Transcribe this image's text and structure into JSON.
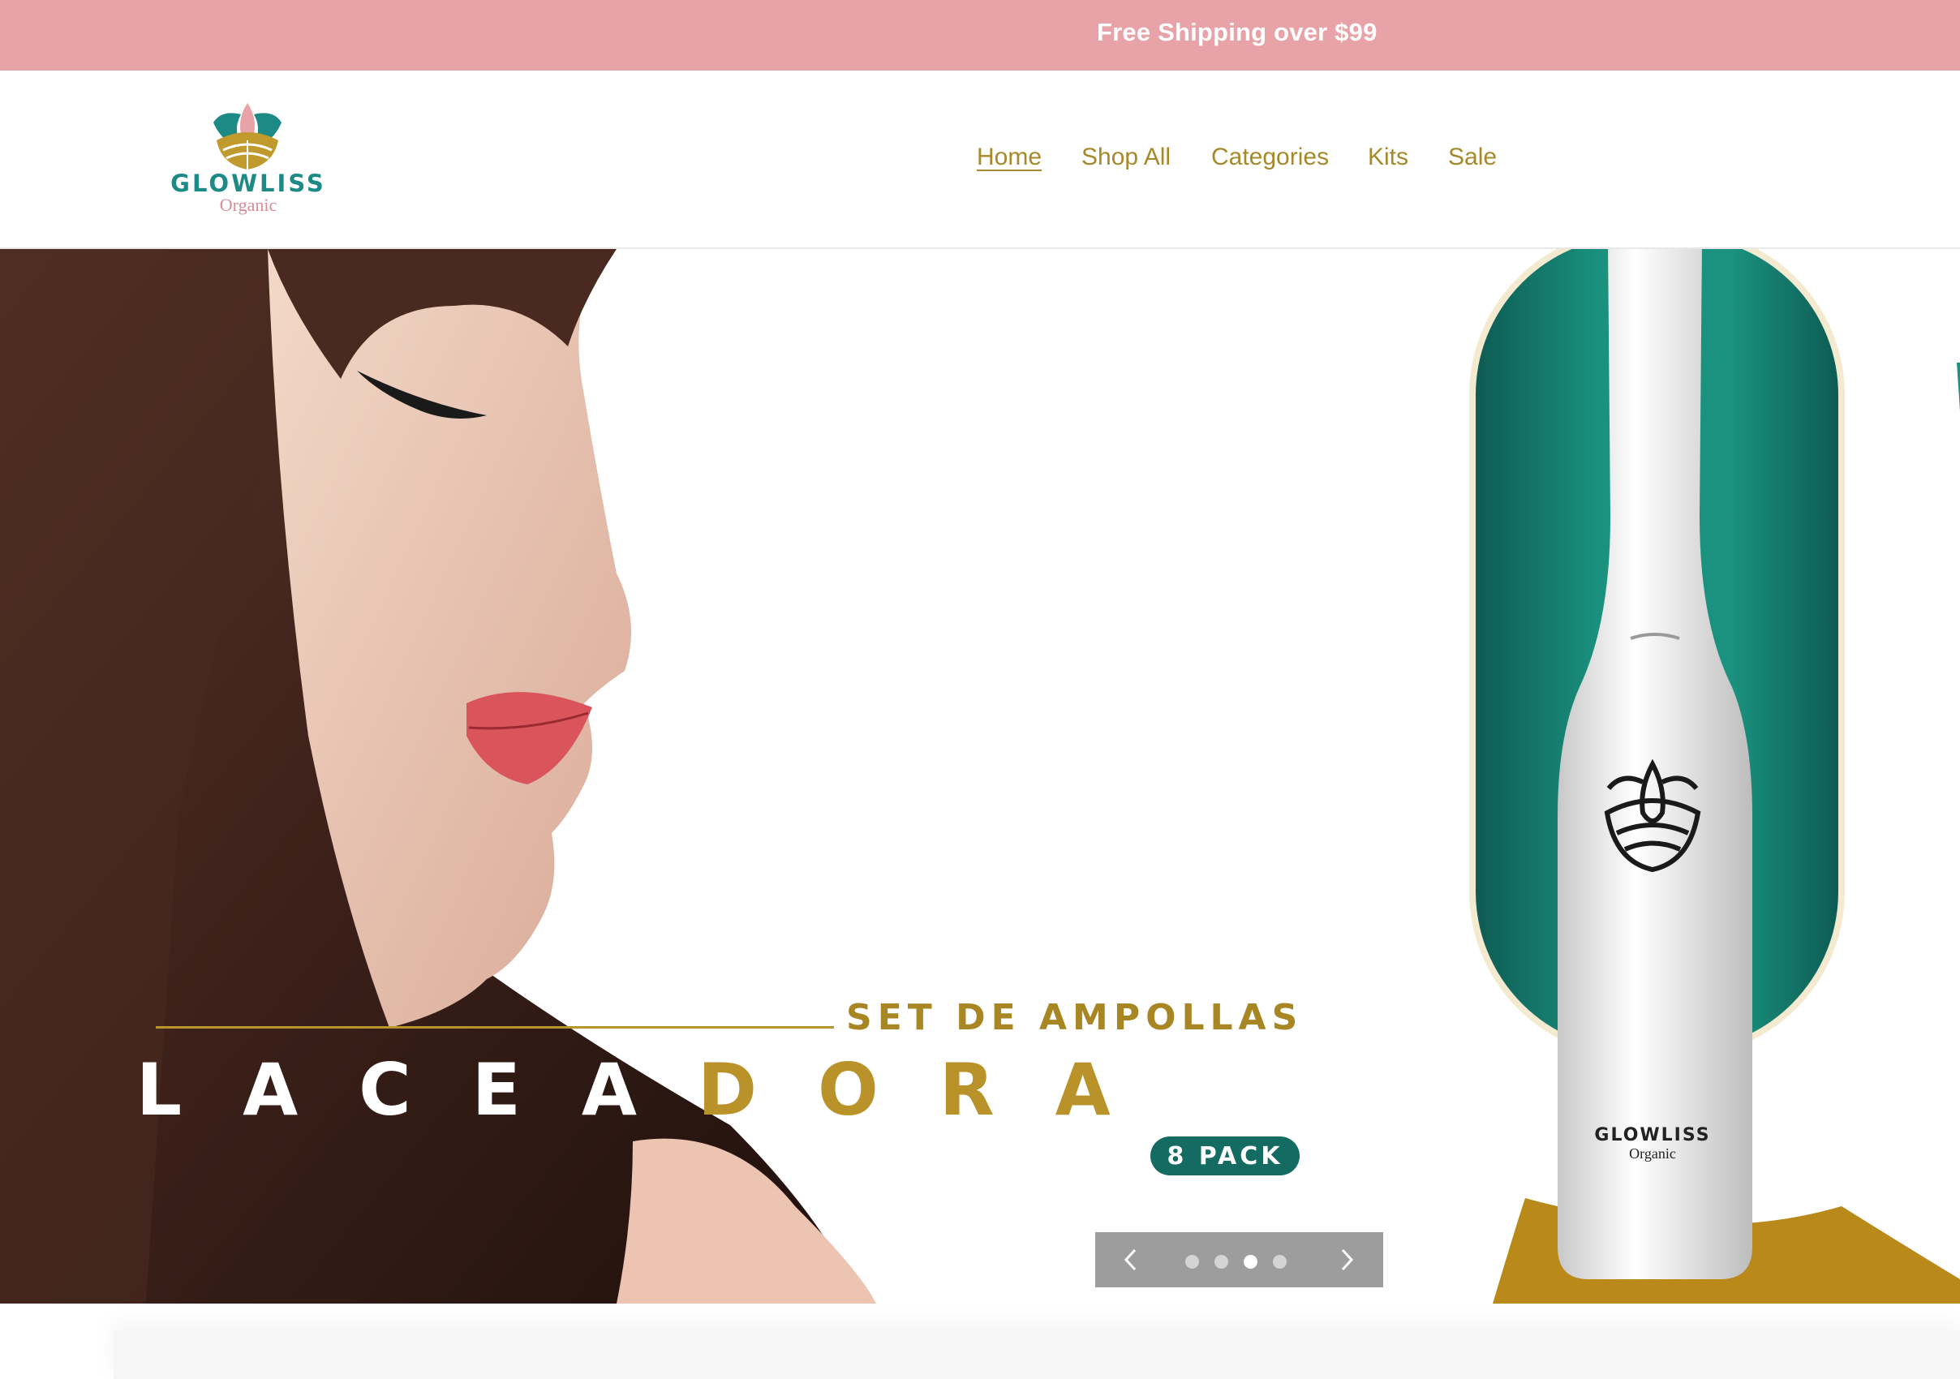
{
  "announcement": {
    "text": "Free Shipping over $99"
  },
  "brand": {
    "name": "GLOWLISS",
    "tagline": "Organic"
  },
  "nav": {
    "items": [
      {
        "label": "Home",
        "active": true
      },
      {
        "label": "Shop All",
        "active": false
      },
      {
        "label": "Categories",
        "active": false
      },
      {
        "label": "Kits",
        "active": false
      },
      {
        "label": "Sale",
        "active": false
      }
    ]
  },
  "hero": {
    "kicker": "SET DE AMPOLLAS",
    "headline_white": "LACEA",
    "headline_gold": "DORA",
    "badge": "8 PACK",
    "product_brand": "GLOWLISS",
    "product_tagline": "Organic"
  },
  "slider": {
    "prev_icon": "chevron-left-icon",
    "next_icon": "chevron-right-icon",
    "slide_count": 4,
    "active_slide": 3
  },
  "colors": {
    "announcement_bg": "#e8a3a8",
    "nav_text": "#a6892a",
    "brand_teal": "#1e8a86",
    "gold": "#b9932a",
    "badge_green": "#146b62"
  }
}
